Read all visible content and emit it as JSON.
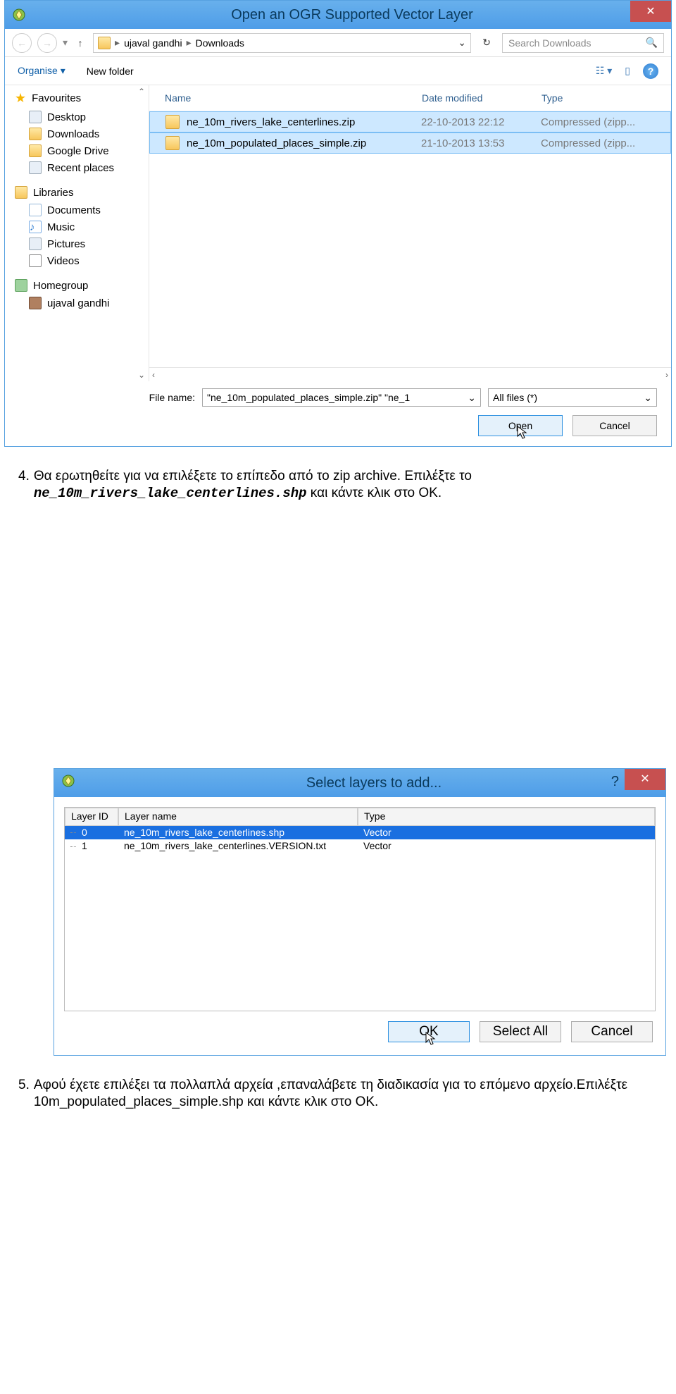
{
  "window1": {
    "title": "Open an OGR Supported Vector Layer",
    "nav": {
      "crumb1": "ujaval gandhi",
      "crumb2": "Downloads",
      "search_placeholder": "Search Downloads"
    },
    "toolbar": {
      "organise": "Organise",
      "newfolder": "New folder"
    },
    "sidebar": {
      "favourites": "Favourites",
      "items_fav": [
        "Desktop",
        "Downloads",
        "Google Drive",
        "Recent places"
      ],
      "libraries": "Libraries",
      "items_lib": [
        "Documents",
        "Music",
        "Pictures",
        "Videos"
      ],
      "homegroup": "Homegroup",
      "items_hg": [
        "ujaval gandhi"
      ]
    },
    "columns": {
      "name": "Name",
      "date": "Date modified",
      "type": "Type"
    },
    "files": [
      {
        "name": "ne_10m_rivers_lake_centerlines.zip",
        "date": "22-10-2013 22:12",
        "type": "Compressed (zipp...",
        "selected": true
      },
      {
        "name": "ne_10m_populated_places_simple.zip",
        "date": "21-10-2013 13:53",
        "type": "Compressed (zipp...",
        "selected": true
      }
    ],
    "footer": {
      "filename_label": "File name:",
      "filename_value": "\"ne_10m_populated_places_simple.zip\" \"ne_1",
      "filter": "All files (*)",
      "open": "Open",
      "cancel": "Cancel"
    }
  },
  "step4": {
    "num": "4.",
    "text_a": "Θα ερωτηθείτε για να επιλέξετε το επίπεδο από το zip archive. Επιλέξτε το ",
    "file": "ne_10m_rivers_lake_centerlines.shp",
    "text_b": " και κάντε κλικ στο OK."
  },
  "window2": {
    "title": "Select layers to add...",
    "cols": {
      "id": "Layer ID",
      "name": "Layer name",
      "type": "Type"
    },
    "rows": [
      {
        "id": "0",
        "name": "ne_10m_rivers_lake_centerlines.shp",
        "type": "Vector",
        "selected": true
      },
      {
        "id": "1",
        "name": "ne_10m_rivers_lake_centerlines.VERSION.txt",
        "type": "Vector",
        "selected": false
      }
    ],
    "buttons": {
      "ok": "OK",
      "selectall": "Select All",
      "cancel": "Cancel"
    }
  },
  "step5": {
    "num": "5.",
    "text": "Αφού έχετε επιλέξει τα πολλαπλά αρχεία ,επαναλάβετε τη διαδικασία για το επόμενο αρχείο.Επιλέξτε 10m_populated_places_simple.shp και κάντε κλικ στο OK."
  }
}
